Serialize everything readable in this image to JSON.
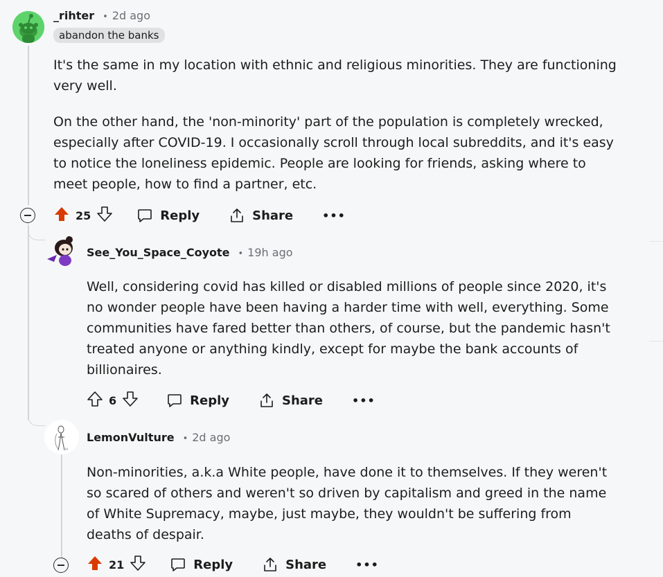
{
  "comments": [
    {
      "username": "_rihter",
      "time": "2d ago",
      "flair": "abandon the banks",
      "paragraphs": [
        "It's the same in my location with ethnic and religious minorities. They are functioning very well.",
        "On the other hand, the 'non-minority' part of the population is completely wrecked, especially after COVID-19. I occasionally scroll through local subreddits, and it's easy to notice the loneliness epidemic. People are looking for friends, asking where to meet people, how to find a partner, etc."
      ],
      "votes": "25",
      "upvoted": true,
      "reply_label": "Reply",
      "share_label": "Share",
      "more_label": "•••",
      "accent_color": "#d93a00"
    },
    {
      "username": "See_You_Space_Coyote",
      "time": "19h ago",
      "body": "Well, considering covid has killed or disabled millions of people since 2020, it's no wonder people have been having a harder time with well, everything. Some communities have fared better than others, of course, but the pandemic hasn't treated anyone or anything kindly, except for maybe the bank accounts of billionaires.",
      "votes": "6",
      "upvoted": false,
      "reply_label": "Reply",
      "share_label": "Share",
      "more_label": "•••"
    },
    {
      "username": "LemonVulture",
      "time": "2d ago",
      "body": "Non-minorities, a.k.a White people, have done it to themselves. If they weren't so scared of others and weren't so driven by capitalism and greed in the name of White Supremacy, maybe, just maybe, they wouldn't be suffering from deaths of despair.",
      "votes": "21",
      "upvoted": true,
      "reply_label": "Reply",
      "share_label": "Share",
      "more_label": "•••"
    }
  ],
  "separator": "•"
}
